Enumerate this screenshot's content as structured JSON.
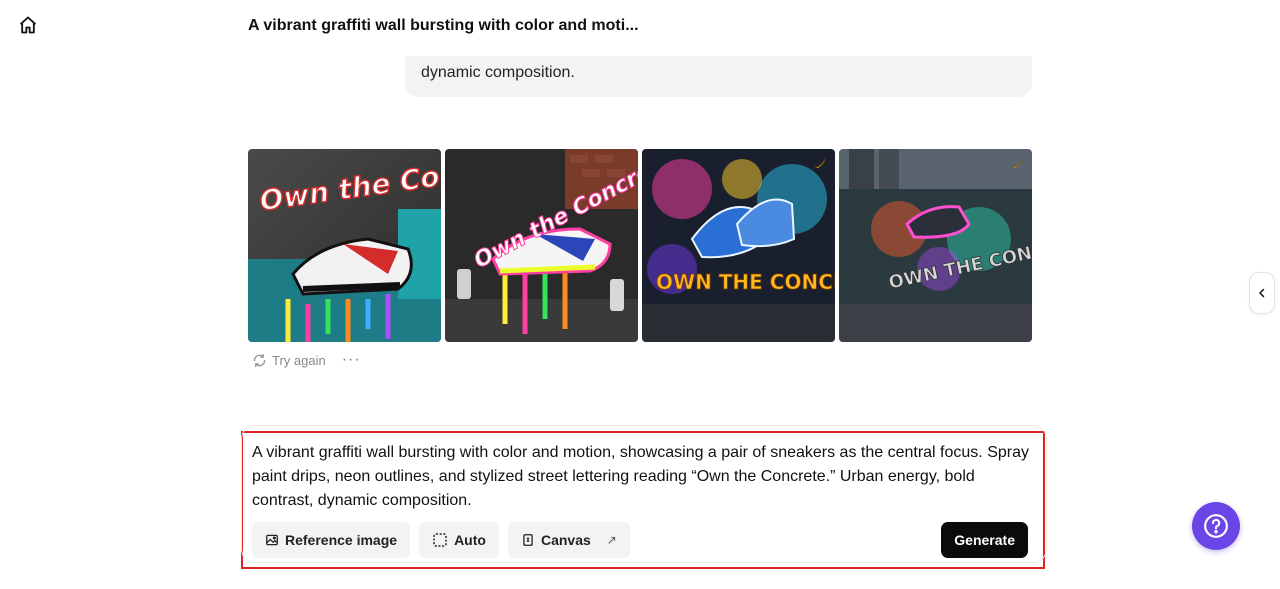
{
  "header": {
    "title": "A vibrant graffiti wall bursting with color and moti...",
    "home_icon": "home-icon"
  },
  "conversation": {
    "previous_prompt_tail": "dynamic composition."
  },
  "results": {
    "images": [
      {
        "name": "generated-image-1",
        "caption_text": "Own the Concrete",
        "badge": false
      },
      {
        "name": "generated-image-2",
        "caption_text": "Own the Concrete",
        "badge": false
      },
      {
        "name": "generated-image-3",
        "caption_text": "OWN THE CONCRETE.",
        "badge": true
      },
      {
        "name": "generated-image-4",
        "caption_text": "OWN THE CONCRETE",
        "badge": true
      }
    ],
    "try_again_label": "Try again",
    "more_label": "···"
  },
  "composer": {
    "prompt": "A vibrant graffiti wall bursting with color and motion, showcasing a pair of sneakers as the central focus. Spray paint drips, neon outlines, and stylized street lettering reading “Own the Concrete.” Urban energy, bold contrast, dynamic composition.",
    "reference_image_label": "Reference image",
    "auto_label": "Auto",
    "canvas_label": "Canvas",
    "canvas_arrow": "↗",
    "generate_label": "Generate"
  },
  "colors": {
    "highlight_border": "#e02424",
    "help_button": "#6a46e6",
    "generate_button": "#0b0b0b"
  }
}
